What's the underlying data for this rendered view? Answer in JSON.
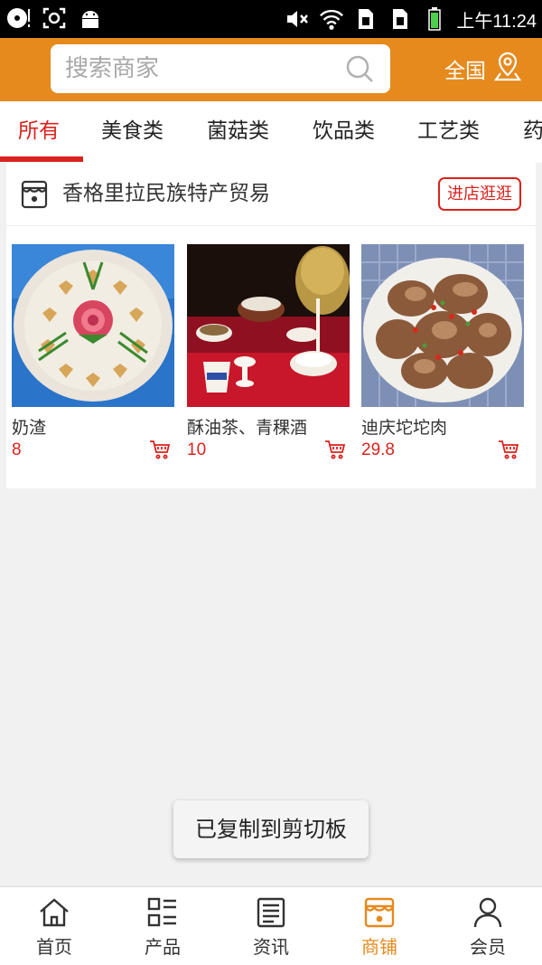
{
  "status_bar": {
    "time": "上午11:24"
  },
  "header": {
    "search_placeholder": "搜索商家",
    "region_label": "全国"
  },
  "tabs": [
    {
      "label": "所有",
      "active": true
    },
    {
      "label": "美食类"
    },
    {
      "label": "菌菇类"
    },
    {
      "label": "饮品类"
    },
    {
      "label": "工艺类"
    },
    {
      "label": "药"
    }
  ],
  "store": {
    "name": "香格里拉民族特产贸易",
    "visit_label": "进店逛逛",
    "products": [
      {
        "name": "奶渣",
        "price": "8"
      },
      {
        "name": "酥油茶、青稞酒",
        "price": "10"
      },
      {
        "name": "迪庆坨坨肉",
        "price": "29.8"
      }
    ]
  },
  "toast": "已复制到剪切板",
  "bottom_nav": [
    {
      "label": "首页",
      "icon": "home-icon"
    },
    {
      "label": "产品",
      "icon": "product-list-icon"
    },
    {
      "label": "资讯",
      "icon": "news-icon"
    },
    {
      "label": "商铺",
      "icon": "store-icon",
      "active": true
    },
    {
      "label": "会员",
      "icon": "member-icon"
    }
  ],
  "colors": {
    "accent": "#e68a1e",
    "active_red": "#d9231d"
  }
}
